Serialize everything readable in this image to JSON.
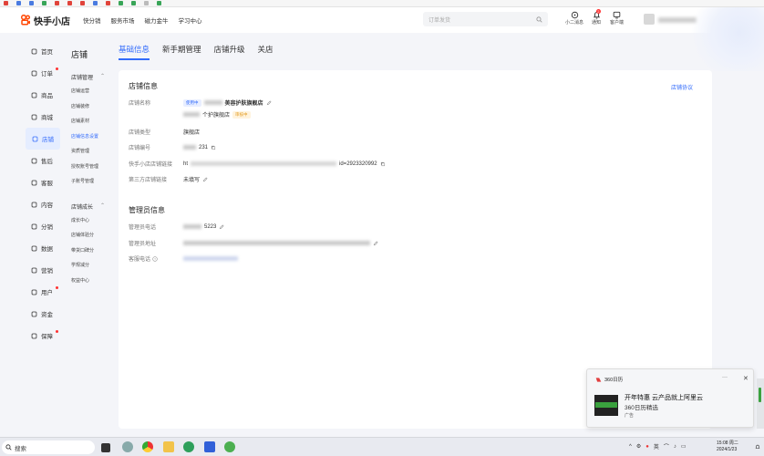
{
  "browser_bookmarks": [
    "",
    "",
    "",
    "",
    "",
    "",
    "",
    "",
    "",
    "",
    "",
    "",
    ""
  ],
  "topnav": {
    "brand": "快手小店",
    "menu": [
      "快分销",
      "服务市场",
      "磁力金牛",
      "学习中心"
    ],
    "search_placeholder": "订单发货",
    "tools": [
      {
        "icon": "headset-icon",
        "label": "小二消息"
      },
      {
        "icon": "bell-icon",
        "label": "通知",
        "badge": "2"
      },
      {
        "icon": "service-icon",
        "label": "客户端"
      }
    ]
  },
  "sidebar": {
    "items": [
      {
        "label": "首页",
        "icon": "home-icon",
        "dot": false,
        "active": false
      },
      {
        "label": "订单",
        "icon": "order-icon",
        "dot": true,
        "active": false
      },
      {
        "label": "商品",
        "icon": "goods-icon",
        "dot": false,
        "active": false
      },
      {
        "label": "商城",
        "icon": "mall-icon",
        "dot": false,
        "active": false
      },
      {
        "label": "店铺",
        "icon": "shop-icon",
        "dot": false,
        "active": true
      },
      {
        "label": "售后",
        "icon": "aftersale-icon",
        "dot": false,
        "active": false
      },
      {
        "label": "客服",
        "icon": "chat-icon",
        "dot": false,
        "active": false
      },
      {
        "label": "内容",
        "icon": "content-icon",
        "dot": false,
        "active": false
      },
      {
        "label": "分销",
        "icon": "distribution-icon",
        "dot": false,
        "active": false
      },
      {
        "label": "数据",
        "icon": "data-icon",
        "dot": false,
        "active": false
      },
      {
        "label": "营销",
        "icon": "marketing-icon",
        "dot": false,
        "active": false
      },
      {
        "label": "用户",
        "icon": "user-icon",
        "dot": true,
        "active": false
      },
      {
        "label": "资金",
        "icon": "funds-icon",
        "dot": false,
        "active": false
      },
      {
        "label": "保障",
        "icon": "shield-icon",
        "dot": true,
        "active": false
      }
    ]
  },
  "subnav": {
    "title": "店铺",
    "groups": [
      {
        "label": "店铺管理",
        "items": [
          "店铺运营",
          "店铺装修",
          "店铺素材",
          "店铺信息设置",
          "资质管理",
          "授权账号管理",
          "子账号管理"
        ],
        "active_index": 3
      },
      {
        "label": "店铺成长",
        "items": [
          "成长中心",
          "店铺体验分",
          "带货口碑分",
          "学规减分",
          "权益中心"
        ],
        "active_index": -1
      }
    ]
  },
  "tabs": [
    "基础信息",
    "新手期管理",
    "店铺升级",
    "关店"
  ],
  "store_info": {
    "section_title": "店铺信息",
    "agreement_link": "店铺协议",
    "name_label": "店铺名称",
    "status_tag": "使用中",
    "name_value": "美容护肤旗舰店",
    "sub_name": "个护旗舰店",
    "audit_tag": "审核中",
    "type_label": "店铺类型",
    "type_value": "旗舰店",
    "id_label": "店铺编号",
    "id_value": "231",
    "link_label": "快手小店店铺链接",
    "link_value": "ht",
    "link_value_tail": "id=2923320992",
    "third_label": "第三方店铺链接",
    "third_value": "未填写"
  },
  "admin_info": {
    "section_title": "管理员信息",
    "phone_label": "管理员电话",
    "phone_value": "5223",
    "address_label": "管理员地址",
    "service_label": "客服电话"
  },
  "notification": {
    "app": "360日历",
    "title": "开年特惠 云产品就上阿里云",
    "subtitle": "360日历精选",
    "ad_label": "广告"
  },
  "taskbar": {
    "search_label": "搜索",
    "time": "15:08 周二",
    "date": "2024/1/23",
    "ime": "英"
  }
}
